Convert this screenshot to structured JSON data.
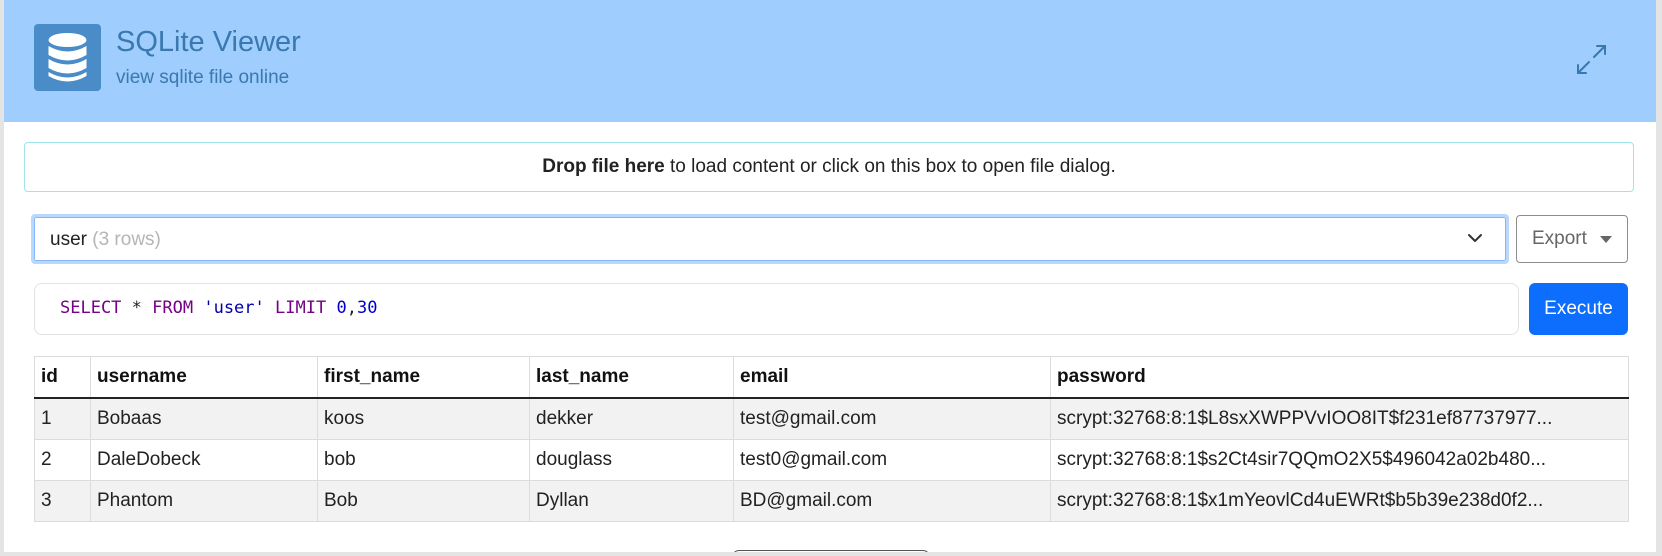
{
  "header": {
    "title": "SQLite Viewer",
    "subtitle": "view sqlite file online",
    "logo_icon": "database-icon",
    "expand_icon": "expand-arrows-icon",
    "background_color": "#9fcdfe"
  },
  "dropzone": {
    "bold_text": "Drop file here",
    "rest_text": " to load content or click on this box to open file dialog."
  },
  "table_select": {
    "selected_table": "user",
    "row_count_text": "(3 rows)",
    "chevron_icon": "chevron-down-icon"
  },
  "export": {
    "label": "Export"
  },
  "query": {
    "tokens": [
      {
        "text": "SELECT",
        "kind": "kw"
      },
      {
        "text": " * ",
        "kind": "plain"
      },
      {
        "text": "FROM",
        "kind": "kw"
      },
      {
        "text": " ",
        "kind": "plain"
      },
      {
        "text": "'user'",
        "kind": "str"
      },
      {
        "text": " ",
        "kind": "plain"
      },
      {
        "text": "LIMIT",
        "kind": "kw"
      },
      {
        "text": " ",
        "kind": "plain"
      },
      {
        "text": "0",
        "kind": "num2"
      },
      {
        "text": ",",
        "kind": "plain"
      },
      {
        "text": "30",
        "kind": "num2"
      }
    ],
    "execute_label": "Execute",
    "execute_color": "#0d6efd"
  },
  "results": {
    "columns": [
      "id",
      "username",
      "first_name",
      "last_name",
      "email",
      "password"
    ],
    "rows": [
      [
        "1",
        "Bobaas",
        "koos",
        "dekker",
        "test@gmail.com",
        "scrypt:32768:8:1$L8sxXWPPVvIOO8IT$f231ef87737977..."
      ],
      [
        "2",
        "DaleDobeck",
        "bob",
        "douglass",
        "test0@gmail.com",
        "scrypt:32768:8:1$s2Ct4sir7QQmO2X5$496042a02b480..."
      ],
      [
        "3",
        "Phantom",
        "Bob",
        "Dyllan",
        "BD@gmail.com",
        "scrypt:32768:8:1$x1mYeovlCd4uEWRt$b5b39e238d0f2..."
      ]
    ]
  }
}
